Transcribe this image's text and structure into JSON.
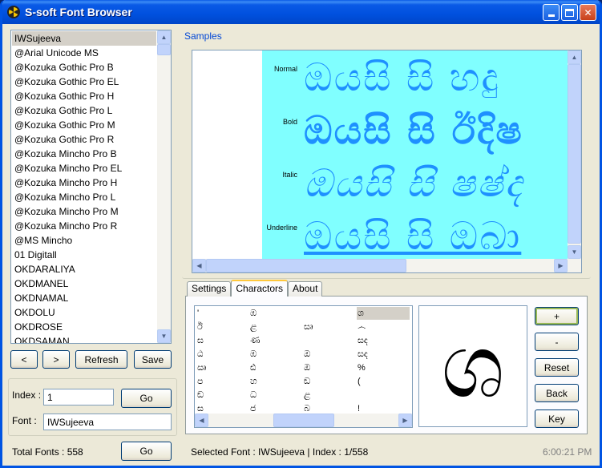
{
  "window": {
    "title": "S-soft Font Browser"
  },
  "font_list": {
    "items": [
      "IWSujeeva",
      "@Arial Unicode MS",
      "@Kozuka Gothic Pro B",
      "@Kozuka Gothic Pro EL",
      "@Kozuka Gothic Pro H",
      "@Kozuka Gothic Pro L",
      "@Kozuka Gothic Pro M",
      "@Kozuka Gothic Pro R",
      "@Kozuka Mincho Pro B",
      "@Kozuka Mincho Pro EL",
      "@Kozuka Mincho Pro H",
      "@Kozuka Mincho Pro L",
      "@Kozuka Mincho Pro M",
      "@Kozuka Mincho Pro R",
      "@MS Mincho",
      "01 Digitall",
      "OKDARALIYA",
      "OKDMANEL",
      "OKDNAMAL",
      "OKDOLU",
      "OKDROSE",
      "OKDSAMAN"
    ],
    "selected_index": 0
  },
  "nav": {
    "prev_label": "<",
    "next_label": ">",
    "refresh_label": "Refresh",
    "save_label": "Save"
  },
  "index_field": {
    "label": "Index :",
    "value": "1",
    "go_label": "Go"
  },
  "font_field": {
    "label": "Font :",
    "value": "IWSujeeva"
  },
  "total": {
    "label": "Total Fonts : 558",
    "go_label": "Go"
  },
  "samples": {
    "label": "Samples",
    "rows": [
      {
        "style": "Normal",
        "text": "ඔයසි  සි  හදු"
      },
      {
        "style": "Bold",
        "text": "ඔයසි  සි  ඊදිෂ"
      },
      {
        "style": "Italic",
        "text": "ඔයසි  සි  ෂෂ්ද"
      },
      {
        "style": "Underline",
        "text": "ඔයසි  සි  ඔබා"
      }
    ]
  },
  "tabs": [
    {
      "label": "Settings",
      "active": false
    },
    {
      "label": "Charactors",
      "active": true
    },
    {
      "label": "About",
      "active": false
    }
  ],
  "char_grid": {
    "rows": [
      [
        "'",
        "ඹ",
        "",
        "ශ"
      ],
      [
        "ඊ",
        "ළ",
        "සෘ",
        "෴"
      ],
      [
        "ඝ",
        "ණ",
        "",
        "සද"
      ],
      [
        "ඨ",
        "ඹ",
        "ඔ",
        "සද"
      ],
      [
        "ඍ",
        "ඪ",
        "ඔ",
        "%"
      ],
      [
        "ප",
        "හ",
        "ඞ",
        "("
      ],
      [
        "ඞ",
        "ධ",
        "ළ",
        ""
      ],
      [
        "ස",
        "ජ",
        "බ",
        "!"
      ]
    ],
    "selected": {
      "row": 0,
      "col": 3
    }
  },
  "preview": {
    "glyph": "ශ"
  },
  "side_buttons": {
    "plus": "+",
    "minus": "-",
    "reset": "Reset",
    "back": "Back",
    "key": "Key"
  },
  "status": {
    "selected_font": "Selected Font :  IWSujeeva  |  Index : 1/558",
    "time": "6:00:21 PM"
  },
  "colors": {
    "title_bar": "#0054e3",
    "sample_bg": "#80ffff",
    "sample_glyph": "#1e90ff",
    "label_blue": "#0046d5"
  }
}
